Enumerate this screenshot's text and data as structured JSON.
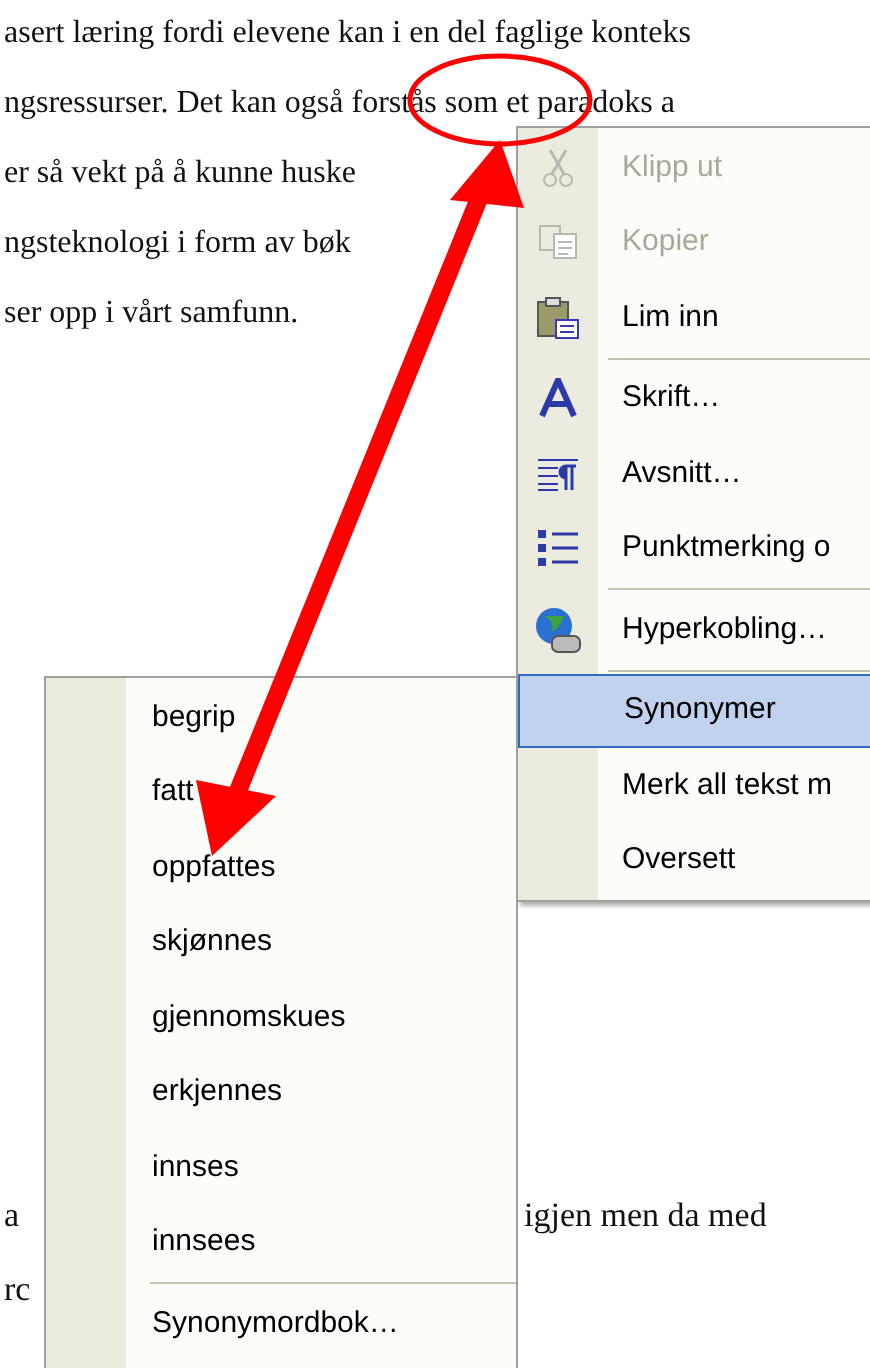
{
  "document": {
    "lines": [
      {
        "text": "asert læring fordi elevene kan i en del faglige konteks"
      },
      {
        "text": "ngsressurser.  Det kan også forstås som et paradoks a"
      },
      {
        "text": "er så vekt på å kunne huske"
      },
      {
        "text": "ngsteknologi  i form av bøk"
      },
      {
        "text": "ser opp i vårt samfunn."
      }
    ],
    "bottom_lines": [
      {
        "left": "a",
        "right": "igjen  men da med"
      },
      {
        "left": "rc"
      }
    ]
  },
  "context_menu": {
    "items": [
      {
        "kind": "item",
        "label": "Klipp ut",
        "disabled": true,
        "selected": false
      },
      {
        "kind": "item",
        "label": "Kopier",
        "disabled": true,
        "selected": false
      },
      {
        "kind": "item",
        "label": "Lim inn",
        "disabled": false,
        "selected": false
      },
      {
        "kind": "separator"
      },
      {
        "kind": "item",
        "label": "Skrift…",
        "disabled": false,
        "selected": false
      },
      {
        "kind": "item",
        "label": "Avsnitt…",
        "disabled": false,
        "selected": false
      },
      {
        "kind": "item",
        "label": "Punktmerking o",
        "disabled": false,
        "selected": false
      },
      {
        "kind": "separator"
      },
      {
        "kind": "item",
        "label": "Hyperkobling…",
        "disabled": false,
        "selected": false
      },
      {
        "kind": "separator"
      },
      {
        "kind": "item",
        "label": "Synonymer",
        "disabled": false,
        "selected": true
      },
      {
        "kind": "item",
        "label": "Merk all tekst m",
        "disabled": false,
        "selected": false
      },
      {
        "kind": "item",
        "label": "Oversett",
        "disabled": false,
        "selected": false
      }
    ]
  },
  "synonym_menu": {
    "items": [
      {
        "kind": "item",
        "label": "begrip"
      },
      {
        "kind": "item",
        "label": "fatt"
      },
      {
        "kind": "item",
        "label": "oppfattes"
      },
      {
        "kind": "item",
        "label": "skjønnes"
      },
      {
        "kind": "item",
        "label": "gjennomskues"
      },
      {
        "kind": "item",
        "label": "erkjennes"
      },
      {
        "kind": "item",
        "label": "innses"
      },
      {
        "kind": "item",
        "label": "innsees"
      },
      {
        "kind": "separator"
      },
      {
        "kind": "item",
        "label": "Synonymordbok…"
      }
    ]
  }
}
